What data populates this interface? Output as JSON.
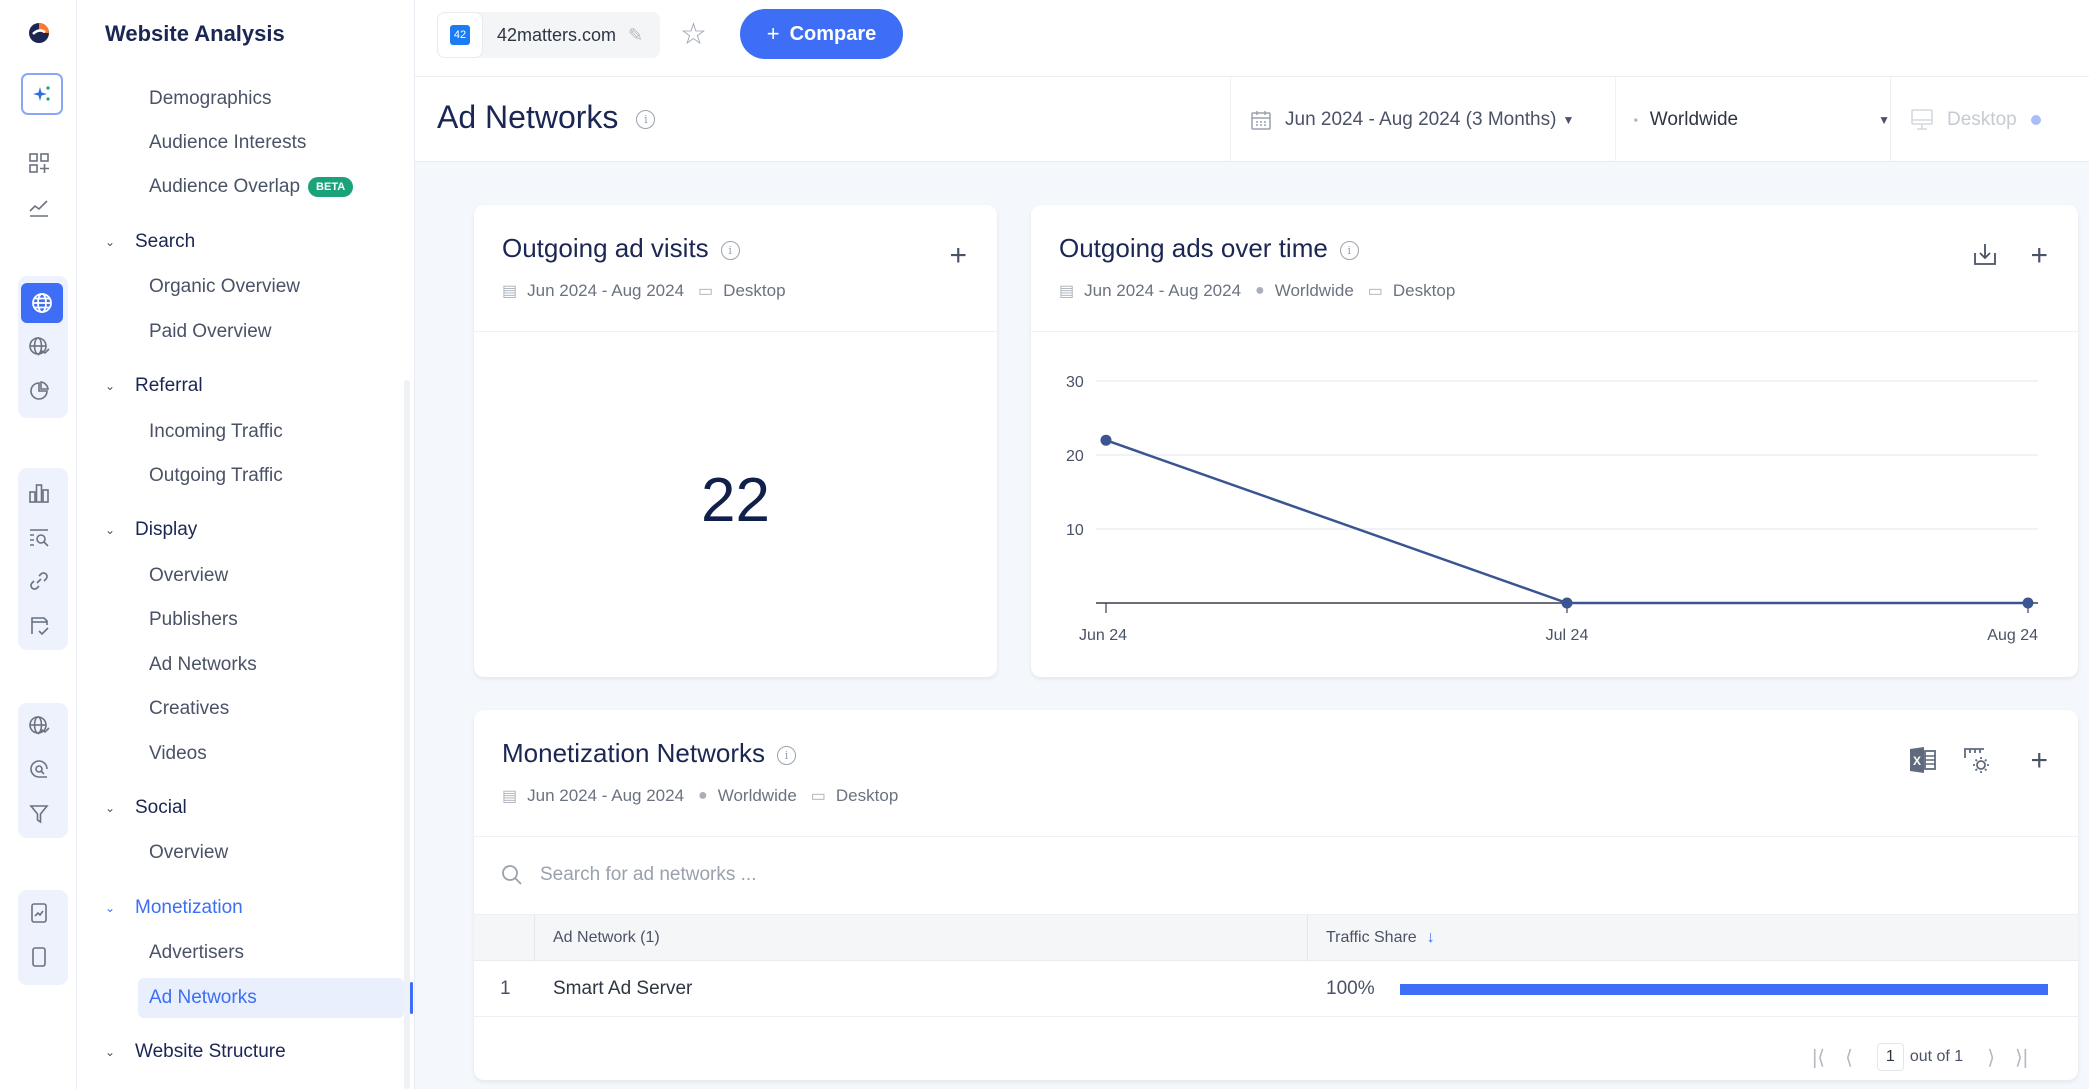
{
  "app": {
    "section_title": "Website Analysis",
    "brand_colors": {
      "accent": "#3d6ef5",
      "beta": "#1aa37a",
      "line": "#3b5592"
    }
  },
  "rail": {
    "icons": [
      "brand-logo-icon",
      "ai-sparkle-icon",
      "dashboard-add-icon",
      "trend-icon",
      "globe-icon",
      "globe-trend-icon",
      "pie-chart-icon",
      "bar-chart-icon",
      "keyword-search-icon",
      "link-icon",
      "checklist-icon",
      "globe-trend-icon",
      "search-at-icon",
      "funnel-icon",
      "report-icon",
      "mobile-icon"
    ]
  },
  "sidebar": {
    "items": [
      {
        "type": "item",
        "label": "Demographics"
      },
      {
        "type": "item",
        "label": "Audience Interests"
      },
      {
        "type": "item",
        "label": "Audience Overlap",
        "badge": "BETA"
      },
      {
        "type": "section",
        "label": "Search"
      },
      {
        "type": "item",
        "label": "Organic Overview"
      },
      {
        "type": "item",
        "label": "Paid Overview"
      },
      {
        "type": "section",
        "label": "Referral"
      },
      {
        "type": "item",
        "label": "Incoming Traffic"
      },
      {
        "type": "item",
        "label": "Outgoing Traffic"
      },
      {
        "type": "section",
        "label": "Display"
      },
      {
        "type": "item",
        "label": "Overview"
      },
      {
        "type": "item",
        "label": "Publishers"
      },
      {
        "type": "item",
        "label": "Ad Networks"
      },
      {
        "type": "item",
        "label": "Creatives"
      },
      {
        "type": "item",
        "label": "Videos"
      },
      {
        "type": "section",
        "label": "Social"
      },
      {
        "type": "item",
        "label": "Overview"
      },
      {
        "type": "section",
        "label": "Monetization",
        "active": true
      },
      {
        "type": "item",
        "label": "Advertisers"
      },
      {
        "type": "item",
        "label": "Ad Networks",
        "active": true
      },
      {
        "type": "section",
        "label": "Website Structure"
      }
    ]
  },
  "topbar": {
    "favicon_text": "42",
    "domain": "42matters.com",
    "compare_label": "Compare"
  },
  "header": {
    "page_title": "Ad Networks",
    "date_filter": "Jun 2024 - Aug 2024 (3 Months)",
    "geo_filter": "Worldwide",
    "device_filter": "Desktop"
  },
  "cards": {
    "visits": {
      "title": "Outgoing ad visits",
      "date": "Jun 2024 - Aug 2024",
      "device": "Desktop",
      "value": "22"
    },
    "over_time": {
      "title": "Outgoing ads over time",
      "date": "Jun 2024 - Aug 2024",
      "geo": "Worldwide",
      "device": "Desktop"
    },
    "networks": {
      "title": "Monetization Networks",
      "date": "Jun 2024 - Aug 2024",
      "geo": "Worldwide",
      "device": "Desktop",
      "search_placeholder": "Search for ad networks ...",
      "columns": [
        "Ad Network (1)",
        "Traffic Share"
      ],
      "rows": [
        {
          "rank": "1",
          "name": "Smart Ad Server",
          "share_label": "100%",
          "share": 1.0
        }
      ],
      "pager": {
        "page": "1",
        "of_label": "out of 1"
      }
    }
  },
  "chart_data": {
    "type": "line",
    "title": "Outgoing ads over time",
    "categories": [
      "Jun 24",
      "Jul 24",
      "Aug 24"
    ],
    "series": [
      {
        "name": "Outgoing ads",
        "values": [
          22,
          0,
          0
        ]
      }
    ],
    "yticks": [
      10,
      20,
      30
    ],
    "ylim": [
      0,
      30
    ],
    "xlabel": "",
    "ylabel": "",
    "grid": true,
    "legend": "none"
  }
}
